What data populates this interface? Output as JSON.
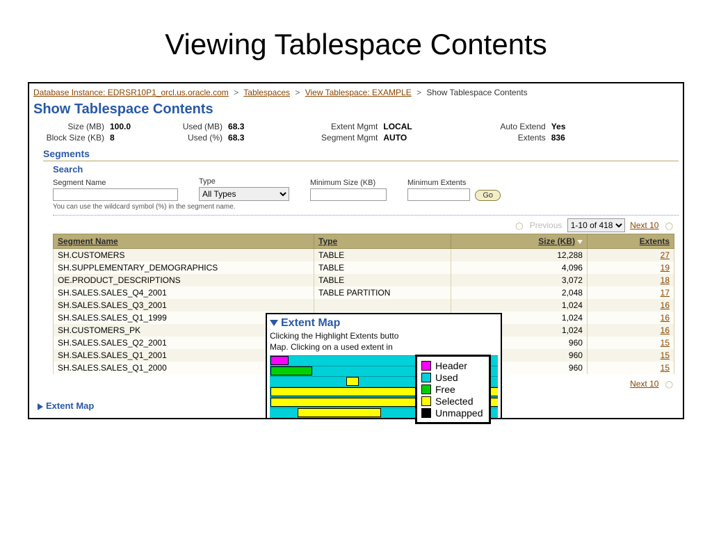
{
  "slide_title": "Viewing Tablespace Contents",
  "breadcrumb": {
    "items": [
      "Database Instance: EDRSR10P1_orcl.us.oracle.com",
      "Tablespaces",
      "View Tablespace: EXAMPLE"
    ],
    "current": "Show Tablespace Contents",
    "sep": ">"
  },
  "page_heading": "Show Tablespace Contents",
  "stats": {
    "size_mb_label": "Size (MB)",
    "size_mb": "100.0",
    "block_size_label": "Block Size (KB)",
    "block_size": "8",
    "used_mb_label": "Used (MB)",
    "used_mb": "68.3",
    "used_pct_label": "Used (%)",
    "used_pct": "68.3",
    "extent_mgmt_label": "Extent Mgmt",
    "extent_mgmt": "LOCAL",
    "segment_mgmt_label": "Segment Mgmt",
    "segment_mgmt": "AUTO",
    "auto_extend_label": "Auto Extend",
    "auto_extend": "Yes",
    "extents_label": "Extents",
    "extents": "836"
  },
  "sections": {
    "segments": "Segments",
    "search": "Search"
  },
  "search": {
    "segment_name_label": "Segment Name",
    "segment_name_value": "",
    "type_label": "Type",
    "type_value": "All Types",
    "min_size_label": "Minimum Size (KB)",
    "min_size_value": "",
    "min_extents_label": "Minimum Extents",
    "min_extents_value": "",
    "go_label": "Go",
    "hint": "You can use the wildcard symbol (%) in the segment name."
  },
  "pager": {
    "previous": "Previous",
    "next": "Next 10",
    "range": "1-10 of 418"
  },
  "table": {
    "headers": {
      "segment_name": "Segment Name",
      "type": "Type",
      "size_kb": "Size (KB)",
      "extents": "Extents"
    },
    "rows": [
      {
        "name": "SH.CUSTOMERS",
        "type": "TABLE",
        "size_kb": "12,288",
        "extents": "27"
      },
      {
        "name": "SH.SUPPLEMENTARY_DEMOGRAPHICS",
        "type": "TABLE",
        "size_kb": "4,096",
        "extents": "19"
      },
      {
        "name": "OE.PRODUCT_DESCRIPTIONS",
        "type": "TABLE",
        "size_kb": "3,072",
        "extents": "18"
      },
      {
        "name": "SH.SALES.SALES_Q4_2001",
        "type": "TABLE PARTITION",
        "size_kb": "2,048",
        "extents": "17"
      },
      {
        "name": "SH.SALES.SALES_Q3_2001",
        "type": "",
        "size_kb": "1,024",
        "extents": "16"
      },
      {
        "name": "SH.SALES.SALES_Q1_1999",
        "type": "",
        "size_kb": "1,024",
        "extents": "16"
      },
      {
        "name": "SH.CUSTOMERS_PK",
        "type": "",
        "size_kb": "1,024",
        "extents": "16"
      },
      {
        "name": "SH.SALES.SALES_Q2_2001",
        "type": "",
        "size_kb": "960",
        "extents": "15"
      },
      {
        "name": "SH.SALES.SALES_Q1_2001",
        "type": "",
        "size_kb": "960",
        "extents": "15"
      },
      {
        "name": "SH.SALES.SALES_Q1_2000",
        "type": "",
        "size_kb": "960",
        "extents": "15"
      }
    ]
  },
  "extent_map_link": "Extent Map",
  "overlay": {
    "title": "Extent Map",
    "desc_line1": "Clicking the Highlight Extents butto",
    "desc_line2": "Map. Clicking on a used extent in"
  },
  "legend": {
    "header": {
      "label": "Header",
      "color": "#ff00ff"
    },
    "used": {
      "label": "Used",
      "color": "#00d0d8"
    },
    "free": {
      "label": "Free",
      "color": "#00d000"
    },
    "selected": {
      "label": "Selected",
      "color": "#ffff00"
    },
    "unmapped": {
      "label": "Unmapped",
      "color": "#000000"
    }
  }
}
